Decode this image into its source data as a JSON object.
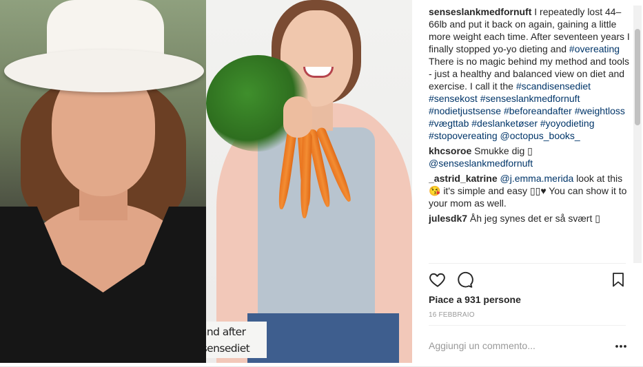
{
  "image": {
    "overlay_line1": "Before and after",
    "overlay_line2": "#scandisensediet"
  },
  "comments": [
    {
      "user": "senseslankmedfornuft",
      "text1": " I repeatedly lost 44–66lb and put it back on again, gaining a little more weight each time. After seventeen years I finally stopped yo-yo dieting and ",
      "tag1": "#overeating",
      "text2": "There is no magic behind my method and tools - just a healthy and balanced view on diet and exercise. I call it the ",
      "hashtags": "#scandisensediet #sensekost #senseslankmedfornuft #nodietjustsense #beforeandafter #weightloss #vægttab #deslanketøser #yoyodieting #stopovereating @octopus_books_"
    },
    {
      "user": "khcsoroe",
      "text": " Smukke dig ▯ ",
      "mention": "@senseslankmedfornuft"
    },
    {
      "user": "_astrid_katrine",
      "mention": "@j.emma.merida",
      "text": " look at this 😘 it's simple and easy ▯▯♥ You can show it to your mom as well."
    },
    {
      "user": "julesdk7",
      "text": " Åh jeg synes det er så svært ▯"
    }
  ],
  "likes": "Piace a 931 persone",
  "date": "16 FEBBRAIO",
  "comment_placeholder": "Aggiungi un commento...",
  "icons": {
    "like": "heart-icon",
    "comment": "comment-bubble-icon",
    "save": "bookmark-icon",
    "more": "more-options-icon"
  },
  "colors": {
    "text": "#262626",
    "link": "#003569",
    "muted": "#999999",
    "divider": "#efefef"
  }
}
